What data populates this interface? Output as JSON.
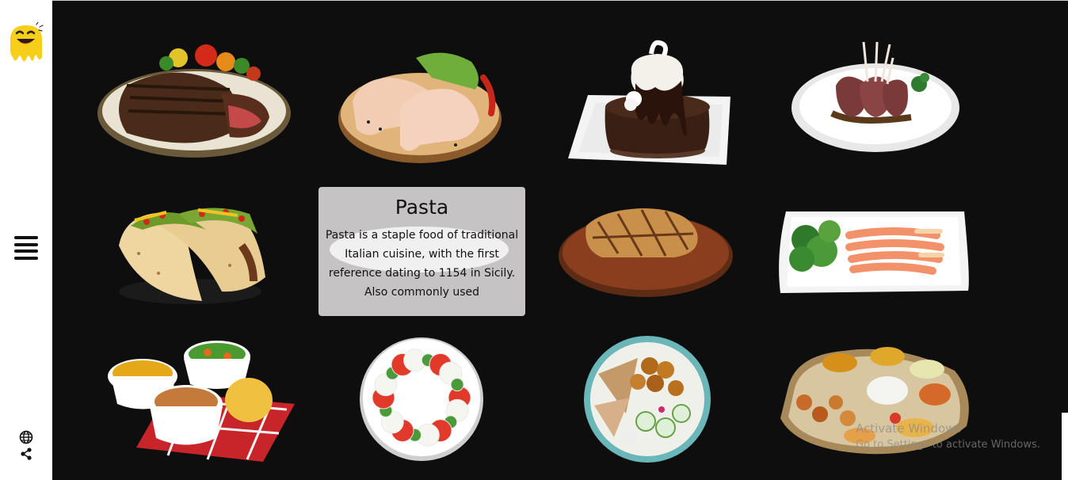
{
  "sidebar": {
    "logo": "smiley-logo",
    "menu": "hamburger-menu-icon",
    "globe": "globe-icon",
    "share": "share-icon"
  },
  "dishes": [
    "steak",
    "raw-chicken",
    "chocolate-cake",
    "lamb-chops",
    "tacos",
    "pasta",
    "grilled-meat",
    "salmon-salad",
    "side-dishes",
    "caprese-salad",
    "falafel-plate",
    "thali"
  ],
  "card": {
    "title": "Pasta",
    "description": "Pasta is a staple food of traditional Italian cuisine, with the first reference dating to 1154 in Sicily. Also commonly used"
  },
  "watermark": {
    "line1": "Activate Windows",
    "line2": "Go to Settings to activate Windows."
  },
  "colors": {
    "background": "#0e0e0e",
    "sidebar": "#ffffff",
    "card": "#c6c3c4"
  }
}
